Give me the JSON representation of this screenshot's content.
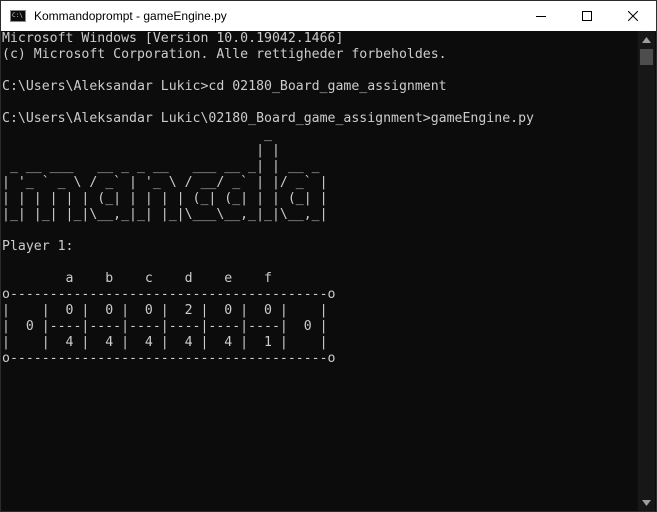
{
  "window": {
    "title": "Kommandoprompt - gameEngine.py",
    "icon_text": "C:\\"
  },
  "icons": {
    "app": "console-icon",
    "minimize": "minimize-icon",
    "maximize": "maximize-icon",
    "close": "close-icon",
    "scroll_up": "chevron-up-icon",
    "scroll_down": "chevron-down-icon"
  },
  "colors": {
    "console_background": "#0c0c0c",
    "console_text": "#cccccc",
    "titlebar": "#ffffff"
  },
  "console": {
    "lines": [
      "Microsoft Windows [Version 10.0.19042.1466]",
      "(c) Microsoft Corporation. Alle rettigheder forbeholdes.",
      "",
      "C:\\Users\\Aleksandar Lukic>cd 02180_Board_game_assignment",
      "",
      "C:\\Users\\Aleksandar Lukic\\02180_Board_game_assignment>gameEngine.py",
      "                                 _",
      "                                | |",
      " _ __ ___   __ _ _ __   ___ __ _| | __ _",
      "| '_ ` _ \\ / _` | '_ \\ / __/ _` | |/ _` |",
      "| | | | | | (_| | | | | (_| (_| | | (_| |",
      "|_| |_| |_|\\__,_|_| |_|\\___\\__,_|_|\\__,_|",
      "",
      "Player 1:",
      "",
      "        a    b    c    d    e    f",
      "o----------------------------------------o",
      "|    |  0 |  0 |  0 |  2 |  0 |  0 |    |",
      "|  0 |----|----|----|----|----|----|  0 |",
      "|    |  4 |  4 |  4 |  4 |  4 |  1 |    |",
      "o----------------------------------------o"
    ]
  }
}
